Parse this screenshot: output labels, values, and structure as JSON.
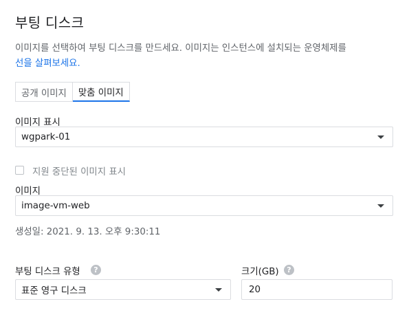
{
  "page": {
    "title": "부팅 디스크",
    "description_line1": "이미지를 선택하여 부팅 디스크를 만드세요. 이미지는 인스턴스에 설치되는 운영체제를",
    "description_link": "선을 살펴보세요."
  },
  "tabs": [
    {
      "label": "공개 이미지",
      "active": false
    },
    {
      "label": "맞춤 이미지",
      "active": true
    }
  ],
  "image_project": {
    "label": "이미지 표시",
    "value": "wgpark-01"
  },
  "deprecated_checkbox": {
    "label": "지원 중단된 이미지 표시",
    "checked": false
  },
  "image": {
    "label": "이미지",
    "value": "image-vm-web",
    "created": "생성일: 2021. 9. 13. 오후 9:30:11"
  },
  "boot_disk_type": {
    "label": "부팅 디스크 유형",
    "value": "표준 영구 디스크"
  },
  "size": {
    "label": "크기(GB)",
    "value": "20"
  },
  "help_glyph": "?",
  "colors": {
    "accent": "#1a73e8",
    "border": "#dadce0",
    "muted": "#5f6368"
  }
}
